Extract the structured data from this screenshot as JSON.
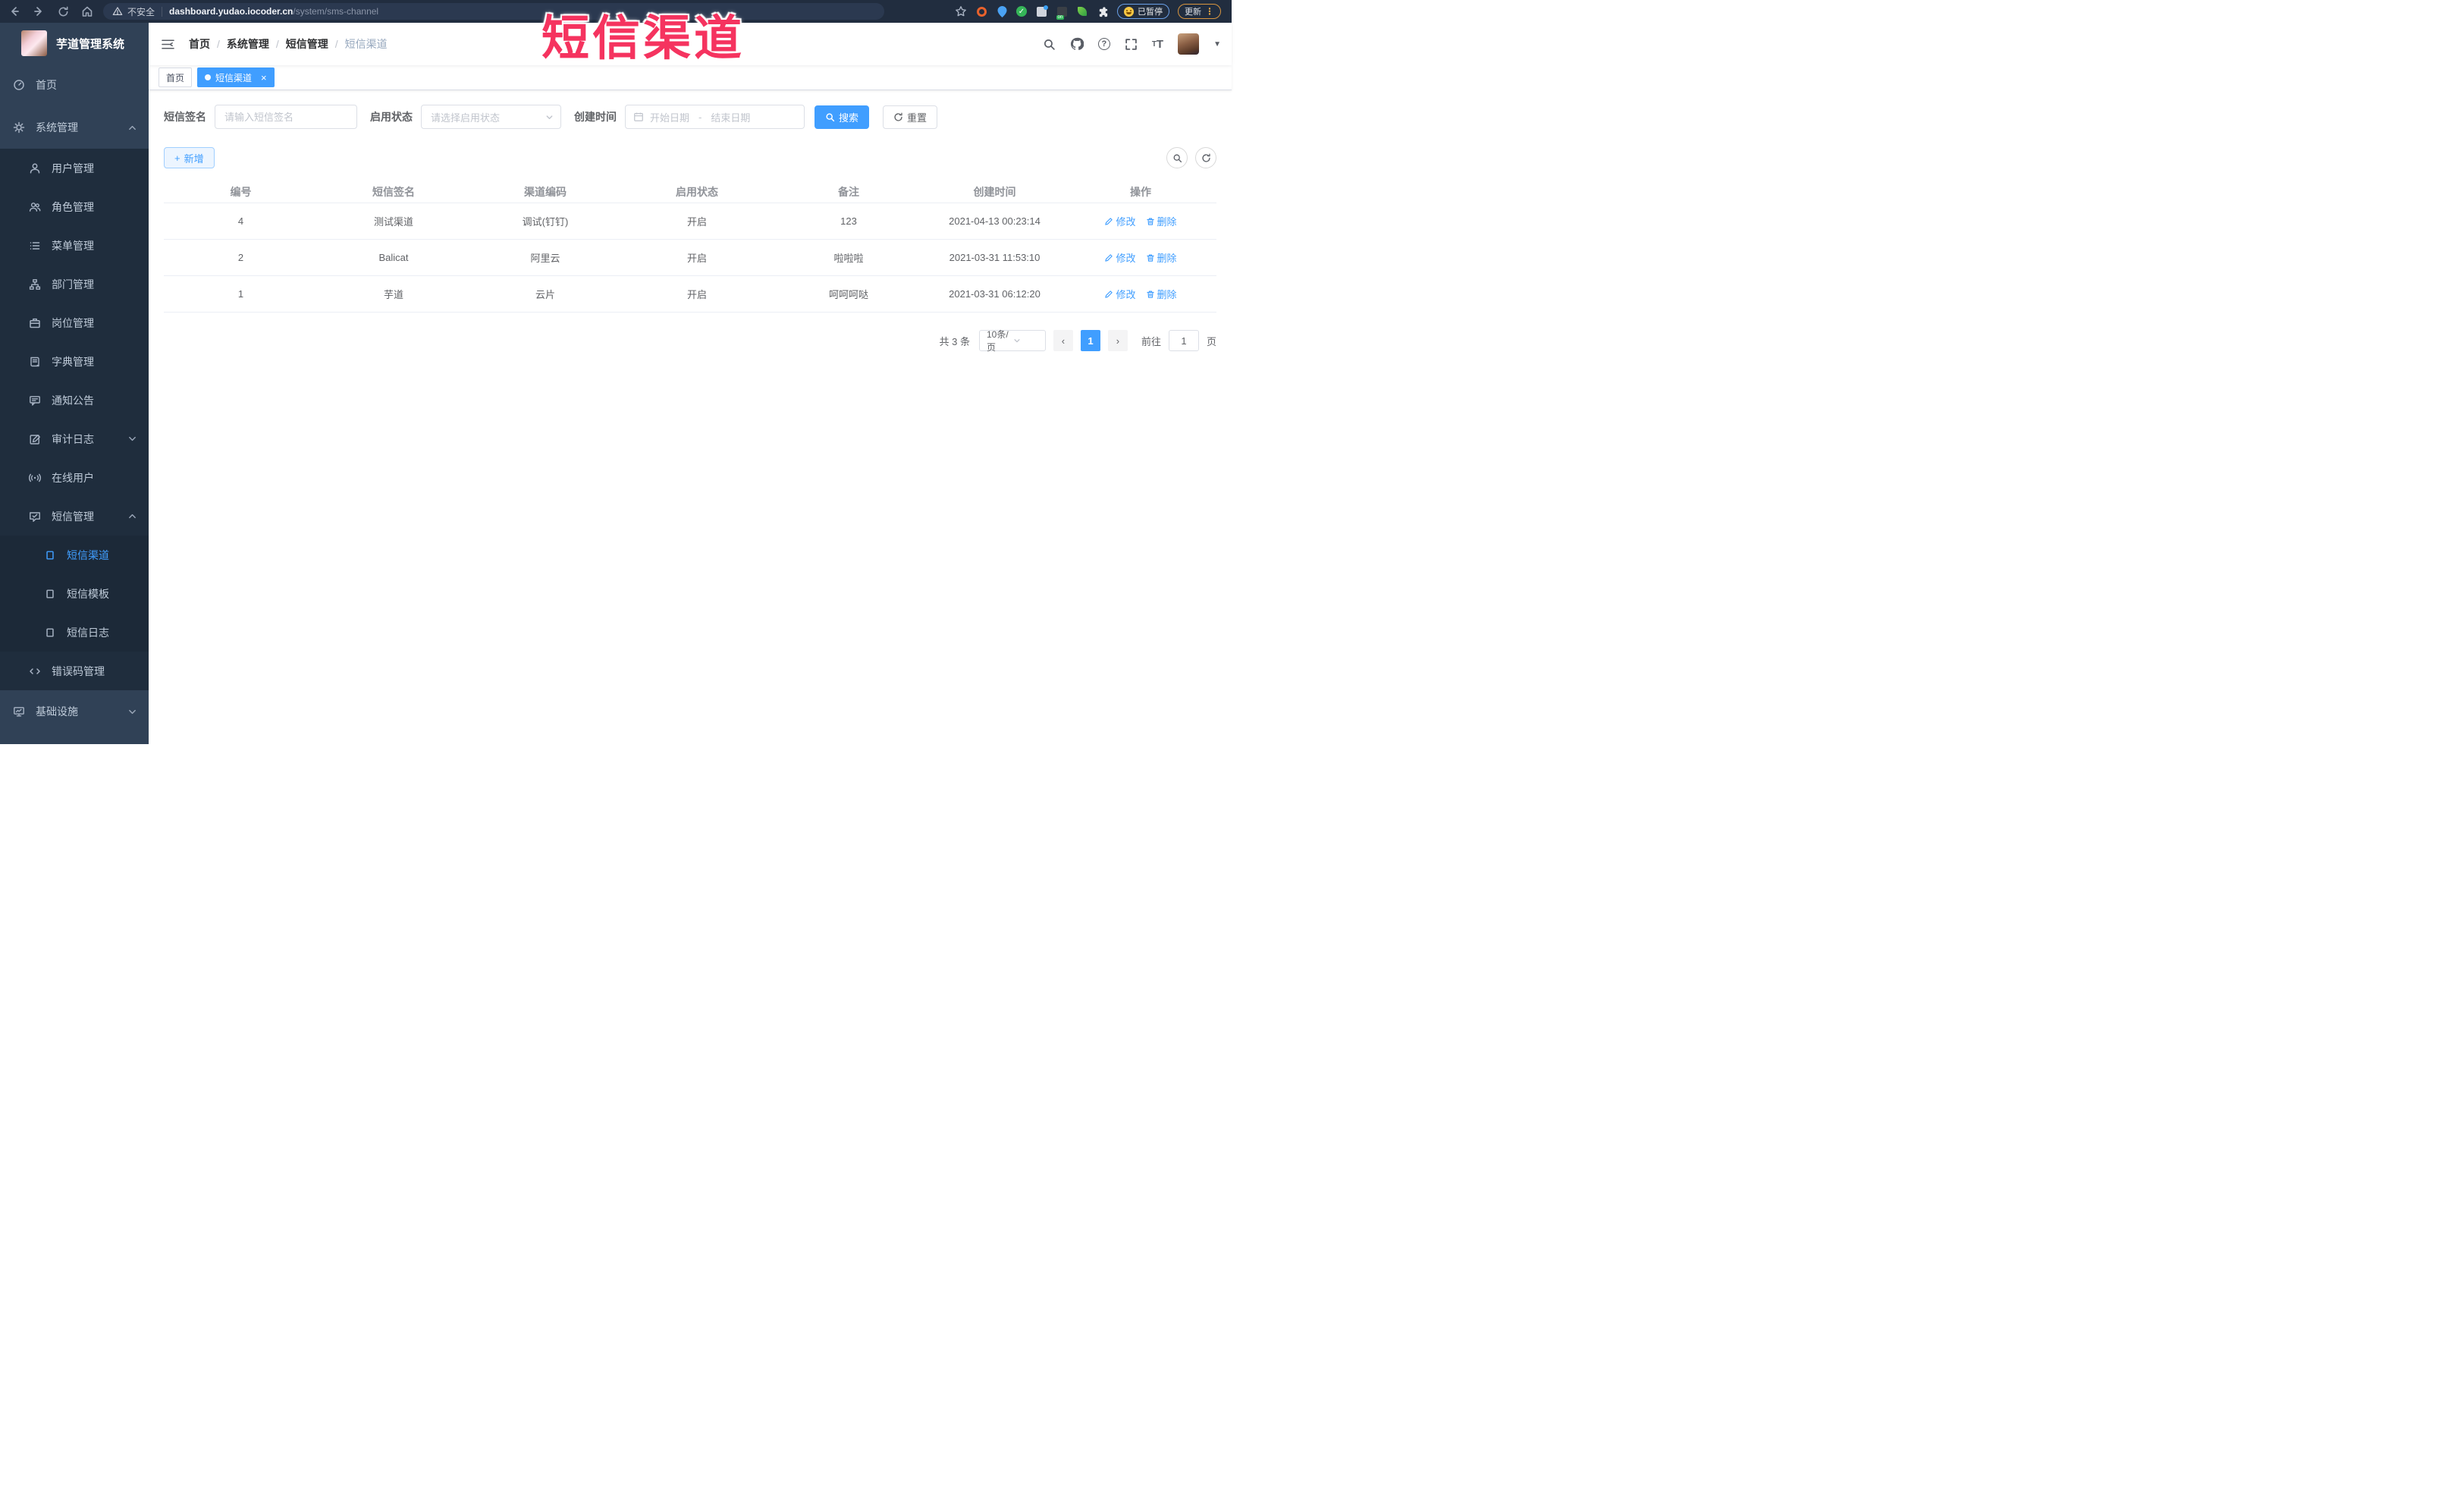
{
  "browser": {
    "security_label": "不安全",
    "url_domain": "dashboard.yudao.iocoder.cn",
    "url_path": "/system/sms-channel",
    "paused_label": "已暂停",
    "update_label": "更新",
    "kebab_glyph": "⋮"
  },
  "watermark": {
    "text": "短信渠道",
    "color": "#f5335f"
  },
  "sidebar": {
    "title": "芋道管理系统",
    "items": [
      {
        "label": "首页"
      },
      {
        "label": "系统管理"
      },
      {
        "label": "用户管理"
      },
      {
        "label": "角色管理"
      },
      {
        "label": "菜单管理"
      },
      {
        "label": "部门管理"
      },
      {
        "label": "岗位管理"
      },
      {
        "label": "字典管理"
      },
      {
        "label": "通知公告"
      },
      {
        "label": "审计日志"
      },
      {
        "label": "在线用户"
      },
      {
        "label": "短信管理"
      },
      {
        "label": "短信渠道"
      },
      {
        "label": "短信模板"
      },
      {
        "label": "短信日志"
      },
      {
        "label": "错误码管理"
      },
      {
        "label": "基础设施"
      }
    ]
  },
  "header": {
    "breadcrumb": [
      "首页",
      "系统管理",
      "短信管理",
      "短信渠道"
    ],
    "separator": "/",
    "help_glyph": "?"
  },
  "tabs": {
    "items": [
      {
        "label": "首页"
      },
      {
        "label": "短信渠道"
      }
    ],
    "close_glyph": "×"
  },
  "filters": {
    "sign_label": "短信签名",
    "sign_placeholder": "请输入短信签名",
    "status_label": "启用状态",
    "status_placeholder": "请选择启用状态",
    "time_label": "创建时间",
    "start_placeholder": "开始日期",
    "range_separator": "-",
    "end_placeholder": "结束日期",
    "search_label": "搜索",
    "reset_label": "重置"
  },
  "toolbar": {
    "add_label": "新增",
    "plus_glyph": "+"
  },
  "table": {
    "columns": [
      "编号",
      "短信签名",
      "渠道编码",
      "启用状态",
      "备注",
      "创建时间",
      "操作"
    ],
    "edit_label": "修改",
    "delete_label": "删除",
    "rows": [
      {
        "id": "4",
        "sign": "测试渠道",
        "code": "调试(钉钉)",
        "status": "开启",
        "remark": "123",
        "created": "2021-04-13 00:23:14"
      },
      {
        "id": "2",
        "sign": "Balicat",
        "code": "阿里云",
        "status": "开启",
        "remark": "啦啦啦",
        "created": "2021-03-31 11:53:10"
      },
      {
        "id": "1",
        "sign": "芋道",
        "code": "云片",
        "status": "开启",
        "remark": "呵呵呵哒",
        "created": "2021-03-31 06:12:20"
      }
    ]
  },
  "pagination": {
    "total": "共 3 条",
    "page_size": "10条/页",
    "prev_glyph": "‹",
    "next_glyph": "›",
    "page": "1",
    "goto_label": "前往",
    "goto_value": "1",
    "unit_label": "页"
  },
  "colors": {
    "accent": "#409EFF",
    "sidebar_bg": "#304156",
    "submenu_bg": "#1f2d3d",
    "chrome_bg": "#212d3f"
  }
}
